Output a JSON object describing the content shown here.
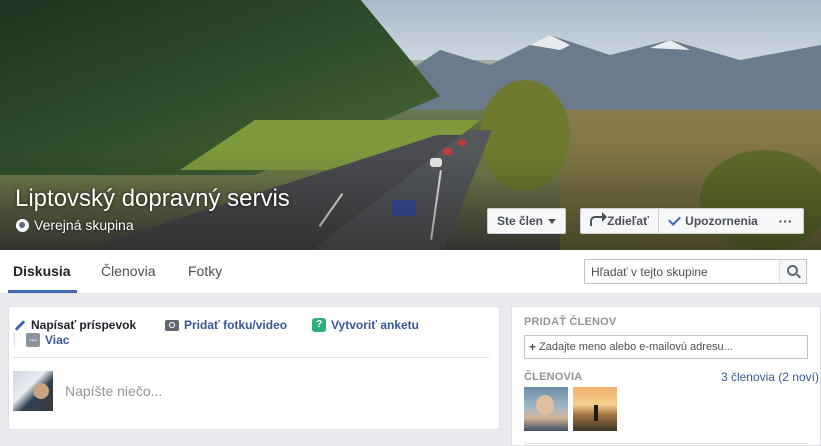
{
  "cover": {
    "group_name": "Liptovský dopravný servis",
    "privacy": "Verejná skupina",
    "member_button": "Ste člen",
    "share_button": "Zdieľať",
    "notifications_button": "Upozornenia",
    "more_button": "···"
  },
  "nav": {
    "tabs": [
      "Diskusia",
      "Členovia",
      "Fotky"
    ],
    "active_tab": "Diskusia",
    "search_placeholder": "Hľadať v tejto skupine"
  },
  "composer": {
    "actions": {
      "post": "Napísať príspevok",
      "photo": "Pridať fotku/video",
      "poll": "Vytvoriť anketu",
      "more": "Viac"
    },
    "placeholder": "Napíšte niečo..."
  },
  "sidebar": {
    "add_members_title": "PRIDAŤ ČLENOV",
    "add_members_placeholder": "Zadajte meno alebo e-mailovú adresu...",
    "members_title": "ČLENOVIA",
    "members_count": "3 členovia (2 noví)"
  },
  "colors": {
    "accent": "#4267b2",
    "link": "#365899",
    "background": "#e9ebee"
  }
}
